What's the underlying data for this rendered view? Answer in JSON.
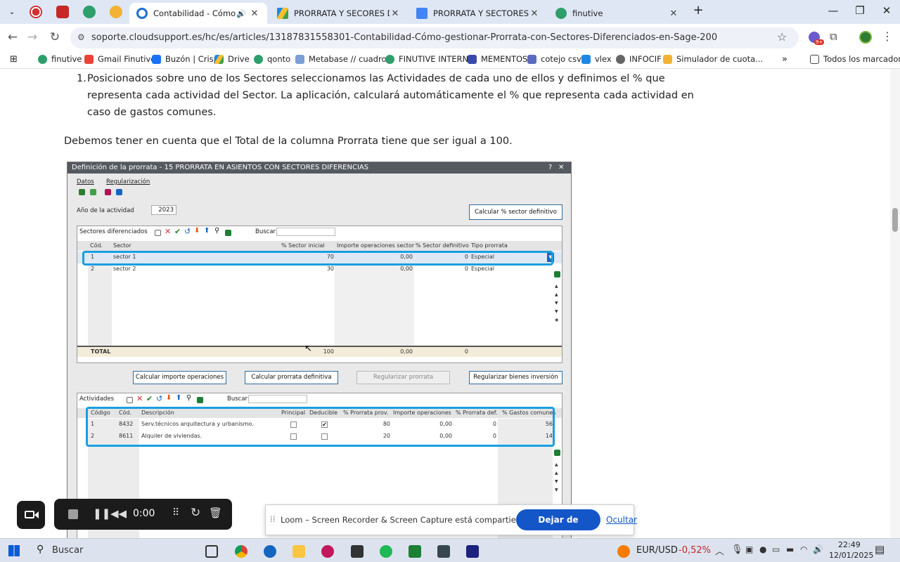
{
  "browser": {
    "tabs": [
      {
        "title": "Contabilidad - Cómo gestio",
        "active": true
      },
      {
        "title": "PRORRATA Y SECORES DIFEREN",
        "active": false
      },
      {
        "title": "PRORRATA Y SECTORES DIFERE",
        "active": false
      },
      {
        "title": "finutive",
        "active": false
      }
    ],
    "url": "soporte.cloudsupport.es/hc/es/articles/13187831558301-Contabilidad-Cómo-gestionar-Prorrata-con-Sectores-Diferenciados-en-Sage-200",
    "bookmarks": [
      "finutive",
      "Gmail Finutive",
      "Buzón | Crisp",
      "Drive",
      "qonto",
      "Metabase // cuadro...",
      "FINUTIVE INTERNO",
      "MEMENTOS",
      "cotejo csv",
      "vlex",
      "INFOCIF",
      "Simulador de cuota..."
    ],
    "all_bookmarks": "Todos los marcadores",
    "extension_badge": "9+"
  },
  "article": {
    "item_number": "1.",
    "item_text_1": "Posicionados sobre uno de los Sectores seleccionamos las Actividades de cada uno de ellos y definimos el % que",
    "item_text_2": "representa cada actividad del Sector. La aplicación, calculará automáticamente el % que representa cada actividad en",
    "item_text_3": "caso de gastos comunes.",
    "note": "Debemos tener en cuenta que el Total de la columna Prorrata tiene que ser igual a 100."
  },
  "sage": {
    "title": "Definición de la prorrata - 15 PRORRATA EN ASIENTOS CON SECTORES DIFERENCIAS",
    "help": "?",
    "close": "✕",
    "menu": [
      "Datos",
      "Regularización"
    ],
    "year_label": "Año de la actividad",
    "year_value": "2023",
    "btn_calc_sector": "Calcular % sector definitivo",
    "sectors_tab": "Sectores diferenciados",
    "search_label": "Buscar:",
    "sector_headers": [
      "Cód.",
      "Sector",
      "% Sector inicial",
      "Importe operaciones sector",
      "% Sector definitivo",
      "Tipo prorrata"
    ],
    "sectors": [
      {
        "code": "1",
        "name": "sector 1",
        "initial": "70",
        "amount": "0,00",
        "final": "0",
        "type": "Especial"
      },
      {
        "code": "2",
        "name": "sector 2",
        "initial": "30",
        "amount": "0,00",
        "final": "0",
        "type": "Especial"
      }
    ],
    "total_label": "TOTAL",
    "total_initial": "100",
    "total_amount": "0,00",
    "total_final": "0",
    "btn_calc_ops": "Calcular importe operaciones",
    "btn_calc_prorrata": "Calcular prorrata definitiva",
    "btn_regularizar": "Regularizar prorrata",
    "btn_bienes": "Regularizar bienes inversión",
    "activities_tab": "Actividades",
    "activity_headers": [
      "Código",
      "Cód.",
      "Descripción",
      "Principal",
      "Deducible",
      "% Prorrata prov.",
      "Importe operaciones",
      "% Prorrata def.",
      "% Gastos comunes"
    ],
    "activities": [
      {
        "code": "1",
        "cod": "8432",
        "desc": "Serv.técnicos arquitectura y urbanismo.",
        "principal": false,
        "deducible": true,
        "prov": "80",
        "amount": "0,00",
        "def": "0",
        "common": "56"
      },
      {
        "code": "2",
        "cod": "8611",
        "desc": "Alquiler de viviendas.",
        "principal": false,
        "deducible": false,
        "prov": "20",
        "amount": "0,00",
        "def": "0",
        "common": "14"
      }
    ]
  },
  "loom": {
    "timer": "0:00",
    "message": "Loom – Screen Recorder & Screen Capture está compartiendo tu pantalla.",
    "stop_button": "Dejar de compartir",
    "hide_link": "Ocultar"
  },
  "taskbar": {
    "search_placeholder": "Buscar",
    "ticker": "EUR/USD",
    "ticker_change": "-0,52%",
    "time": "22:49",
    "date": "12/01/2025"
  },
  "colors": {
    "accent": "#0b57d0",
    "highlight": "#1a9ee0",
    "loom_blue": "#1456c8",
    "negative": "#c62828"
  }
}
